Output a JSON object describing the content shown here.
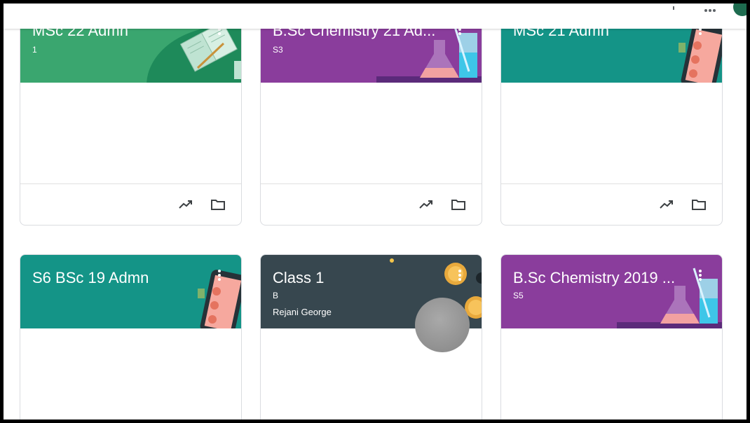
{
  "colors": {
    "green": "#3aa66f",
    "purple": "#8a3d9c",
    "teal": "#149487",
    "dark_slate": "#37474f"
  },
  "cards": [
    {
      "title": "MSc 22 Admn",
      "subtitle": "1",
      "teacher": "",
      "theme": "green",
      "illustration": "notebook-illustration"
    },
    {
      "title": "B.Sc Chemistry 21 Ad...",
      "subtitle": "S3",
      "teacher": "",
      "theme": "purple",
      "illustration": "chemistry-flask-illustration"
    },
    {
      "title": "MSc 21 Admn",
      "subtitle": "",
      "teacher": "",
      "theme": "teal",
      "illustration": "phone-illustration"
    },
    {
      "title": "S6 BSc 19 Admn",
      "subtitle": "",
      "teacher": "",
      "theme": "teal",
      "illustration": "phone-illustration"
    },
    {
      "title": "Class 1",
      "subtitle": "B",
      "teacher": "Rejani George",
      "theme": "dark_slate",
      "illustration": "coins-illustration"
    },
    {
      "title": "B.Sc Chemistry 2019 ...",
      "subtitle": "S5",
      "teacher": "",
      "theme": "purple",
      "illustration": "chemistry-flask-illustration"
    }
  ],
  "footer_icons": [
    "trend-icon",
    "folder-icon"
  ]
}
